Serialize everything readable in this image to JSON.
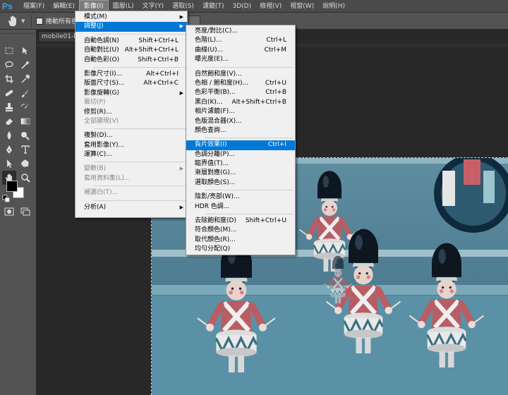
{
  "app": {
    "logo": "Ps"
  },
  "menubar": [
    "檔案(F)",
    "編輯(E)",
    "影像(I)",
    "圖層(L)",
    "文字(Y)",
    "選取(S)",
    "濾鏡(T)",
    "3D(D)",
    "檢視(V)",
    "視窗(W)",
    "說明(H)"
  ],
  "options_bar": {
    "checkbox_label": "捲動所有視窗"
  },
  "document": {
    "tab_label": "mobile01-b4"
  },
  "image_menu": {
    "items": [
      {
        "label": "模式(M)",
        "arrow": true
      },
      {
        "label": "調整(J)",
        "arrow": true,
        "highlighted": true
      },
      {
        "divider": true
      },
      {
        "label": "自動色調(N)",
        "shortcut": "Shift+Ctrl+L"
      },
      {
        "label": "自動對比(U)",
        "shortcut": "Alt+Shift+Ctrl+L"
      },
      {
        "label": "自動色彩(O)",
        "shortcut": "Shift+Ctrl+B"
      },
      {
        "divider": true
      },
      {
        "label": "影像尺寸(I)...",
        "shortcut": "Alt+Ctrl+I"
      },
      {
        "label": "版面尺寸(S)...",
        "shortcut": "Alt+Ctrl+C"
      },
      {
        "label": "影像旋轉(G)",
        "arrow": true
      },
      {
        "label": "裁切(P)",
        "disabled": true
      },
      {
        "label": "修剪(R)..."
      },
      {
        "label": "全部顯現(V)",
        "disabled": true
      },
      {
        "divider": true
      },
      {
        "label": "複製(D)..."
      },
      {
        "label": "套用影像(Y)..."
      },
      {
        "label": "運算(C)..."
      },
      {
        "divider": true
      },
      {
        "label": "變數(B)",
        "arrow": true,
        "disabled": true
      },
      {
        "label": "套用資料集(L)...",
        "disabled": true
      },
      {
        "divider": true
      },
      {
        "label": "補漏白(T)...",
        "disabled": true
      },
      {
        "divider": true
      },
      {
        "label": "分析(A)",
        "arrow": true
      }
    ]
  },
  "adjust_menu": {
    "items": [
      {
        "label": "亮度/對比(C)..."
      },
      {
        "label": "色階(L)...",
        "shortcut": "Ctrl+L"
      },
      {
        "label": "曲線(U)...",
        "shortcut": "Ctrl+M"
      },
      {
        "label": "曝光度(E)..."
      },
      {
        "divider": true
      },
      {
        "label": "自然飽和度(V)..."
      },
      {
        "label": "色相 / 飽和度(H)...",
        "shortcut": "Ctrl+U"
      },
      {
        "label": "色彩平衡(B)...",
        "shortcut": "Ctrl+B"
      },
      {
        "label": "黑白(K)...",
        "shortcut": "Alt+Shift+Ctrl+B"
      },
      {
        "label": "相片濾鏡(F)..."
      },
      {
        "label": "色版混合器(X)..."
      },
      {
        "label": "顏色查詢..."
      },
      {
        "divider": true
      },
      {
        "label": "負片效果(I)",
        "shortcut": "Ctrl+I",
        "highlighted": true
      },
      {
        "label": "色調分離(P)..."
      },
      {
        "label": "臨界值(T)..."
      },
      {
        "label": "漸層對應(G)..."
      },
      {
        "label": "選取顏色(S)..."
      },
      {
        "divider": true
      },
      {
        "label": "陰影/亮部(W)..."
      },
      {
        "label": "HDR 色調..."
      },
      {
        "divider": true
      },
      {
        "label": "去除飽和度(D)",
        "shortcut": "Shift+Ctrl+U"
      },
      {
        "label": "符合顏色(M)..."
      },
      {
        "label": "取代顏色(R)..."
      },
      {
        "label": "均勻分配(Q)"
      }
    ]
  },
  "colors": {
    "highlight": "#0078d7",
    "menu_bg": "#f0f0f0",
    "ui_dark": "#282828",
    "ui_panel": "#535353"
  },
  "tools": [
    "marquee-icon",
    "move-icon",
    "lasso-icon",
    "magic-wand-icon",
    "crop-icon",
    "eyedropper-icon",
    "healing-icon",
    "brush-icon",
    "stamp-icon",
    "history-brush-icon",
    "eraser-icon",
    "gradient-icon",
    "blur-icon",
    "dodge-icon",
    "pen-icon",
    "type-icon",
    "path-select-icon",
    "shape-icon",
    "hand-icon",
    "zoom-icon"
  ]
}
